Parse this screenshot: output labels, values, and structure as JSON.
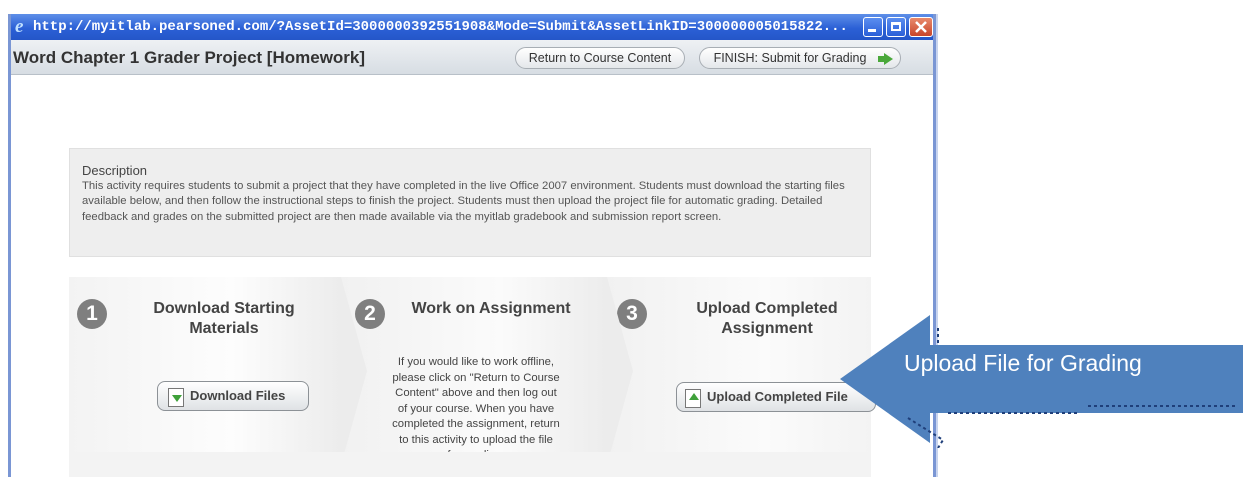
{
  "window": {
    "url": "http://myitlab.pearsoned.com/?AssetId=3000000392551908&Mode=Submit&AssetLinkID=30000000501582​2...",
    "icon": "ie-icon",
    "controls": [
      "minimize-icon",
      "maximize-icon",
      "close-icon"
    ]
  },
  "header": {
    "title": "Word Chapter 1 Grader Project [Homework]",
    "return_label": "Return to Course Content",
    "finish_label": "FINISH: Submit for Grading"
  },
  "description": {
    "title": "Description",
    "text": "This activity requires students to submit a project that they have completed in the live Office 2007 environment. Students must download the starting files available below, and then follow the instructional steps to finish the project. Students must then upload the project file for automatic grading. Detailed feedback and grades on the submitted project are then made available via the myitlab gradebook and submission report screen."
  },
  "steps": [
    {
      "number": "1",
      "title": "Download Starting Materials",
      "button": "Download Files"
    },
    {
      "number": "2",
      "title": "Work on Assignment",
      "text": "If you would like to work offline, please click on \"Return to Course Content\" above and then log out of your course. When you have completed the assignment, return to this activity to upload the file for grading."
    },
    {
      "number": "3",
      "title": "Upload Completed Assignment",
      "button": "Upload Completed File"
    }
  ],
  "callout": {
    "text": "Upload File for Grading",
    "color": "#4f81bd"
  }
}
